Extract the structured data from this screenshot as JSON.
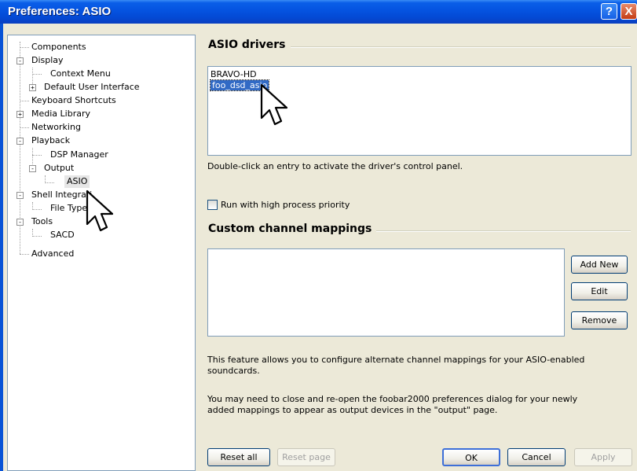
{
  "window": {
    "title": "Preferences: ASIO",
    "help_glyph": "?",
    "close_glyph": "X"
  },
  "tree": {
    "items": [
      {
        "label": "Components"
      },
      {
        "label": "Display",
        "toggle": "-"
      },
      {
        "label": "Context Menu"
      },
      {
        "label": "Default User Interface",
        "toggle": "+"
      },
      {
        "label": "Keyboard Shortcuts"
      },
      {
        "label": "Media Library",
        "toggle": "+"
      },
      {
        "label": "Networking"
      },
      {
        "label": "Playback",
        "toggle": "-"
      },
      {
        "label": "DSP Manager"
      },
      {
        "label": "Output",
        "toggle": "-"
      },
      {
        "label": "ASIO"
      },
      {
        "label": "Shell Integrati",
        "toggle": "-"
      },
      {
        "label": "File Types"
      },
      {
        "label": "Tools",
        "toggle": "-"
      },
      {
        "label": "SACD"
      },
      {
        "label": "Advanced"
      }
    ]
  },
  "asio": {
    "section_title": "ASIO drivers",
    "drivers": [
      "BRAVO-HD",
      "foo_dsd_asio"
    ],
    "hint": "Double-click an entry to activate the driver's control panel.",
    "priority_label": "Run with high process priority"
  },
  "mappings": {
    "section_title": "Custom channel mappings",
    "add_new": "Add New",
    "edit": "Edit",
    "remove": "Remove",
    "info1_line1": "This feature allows you to configure alternate channel mappings for your ASIO-enabled",
    "info1_line2": "soundcards.",
    "info2_line1": "You may need to close and re-open the foobar2000 preferences dialog for your newly",
    "info2_line2": "added mappings to appear as output devices in the \"output\" page."
  },
  "footer": {
    "reset_all": "Reset all",
    "reset_page": "Reset page",
    "ok": "OK",
    "cancel": "Cancel",
    "apply": "Apply"
  },
  "colors": {
    "title_bar": "#0553e0",
    "selection": "#316ac5",
    "dialog_bg": "#ece9d8"
  }
}
